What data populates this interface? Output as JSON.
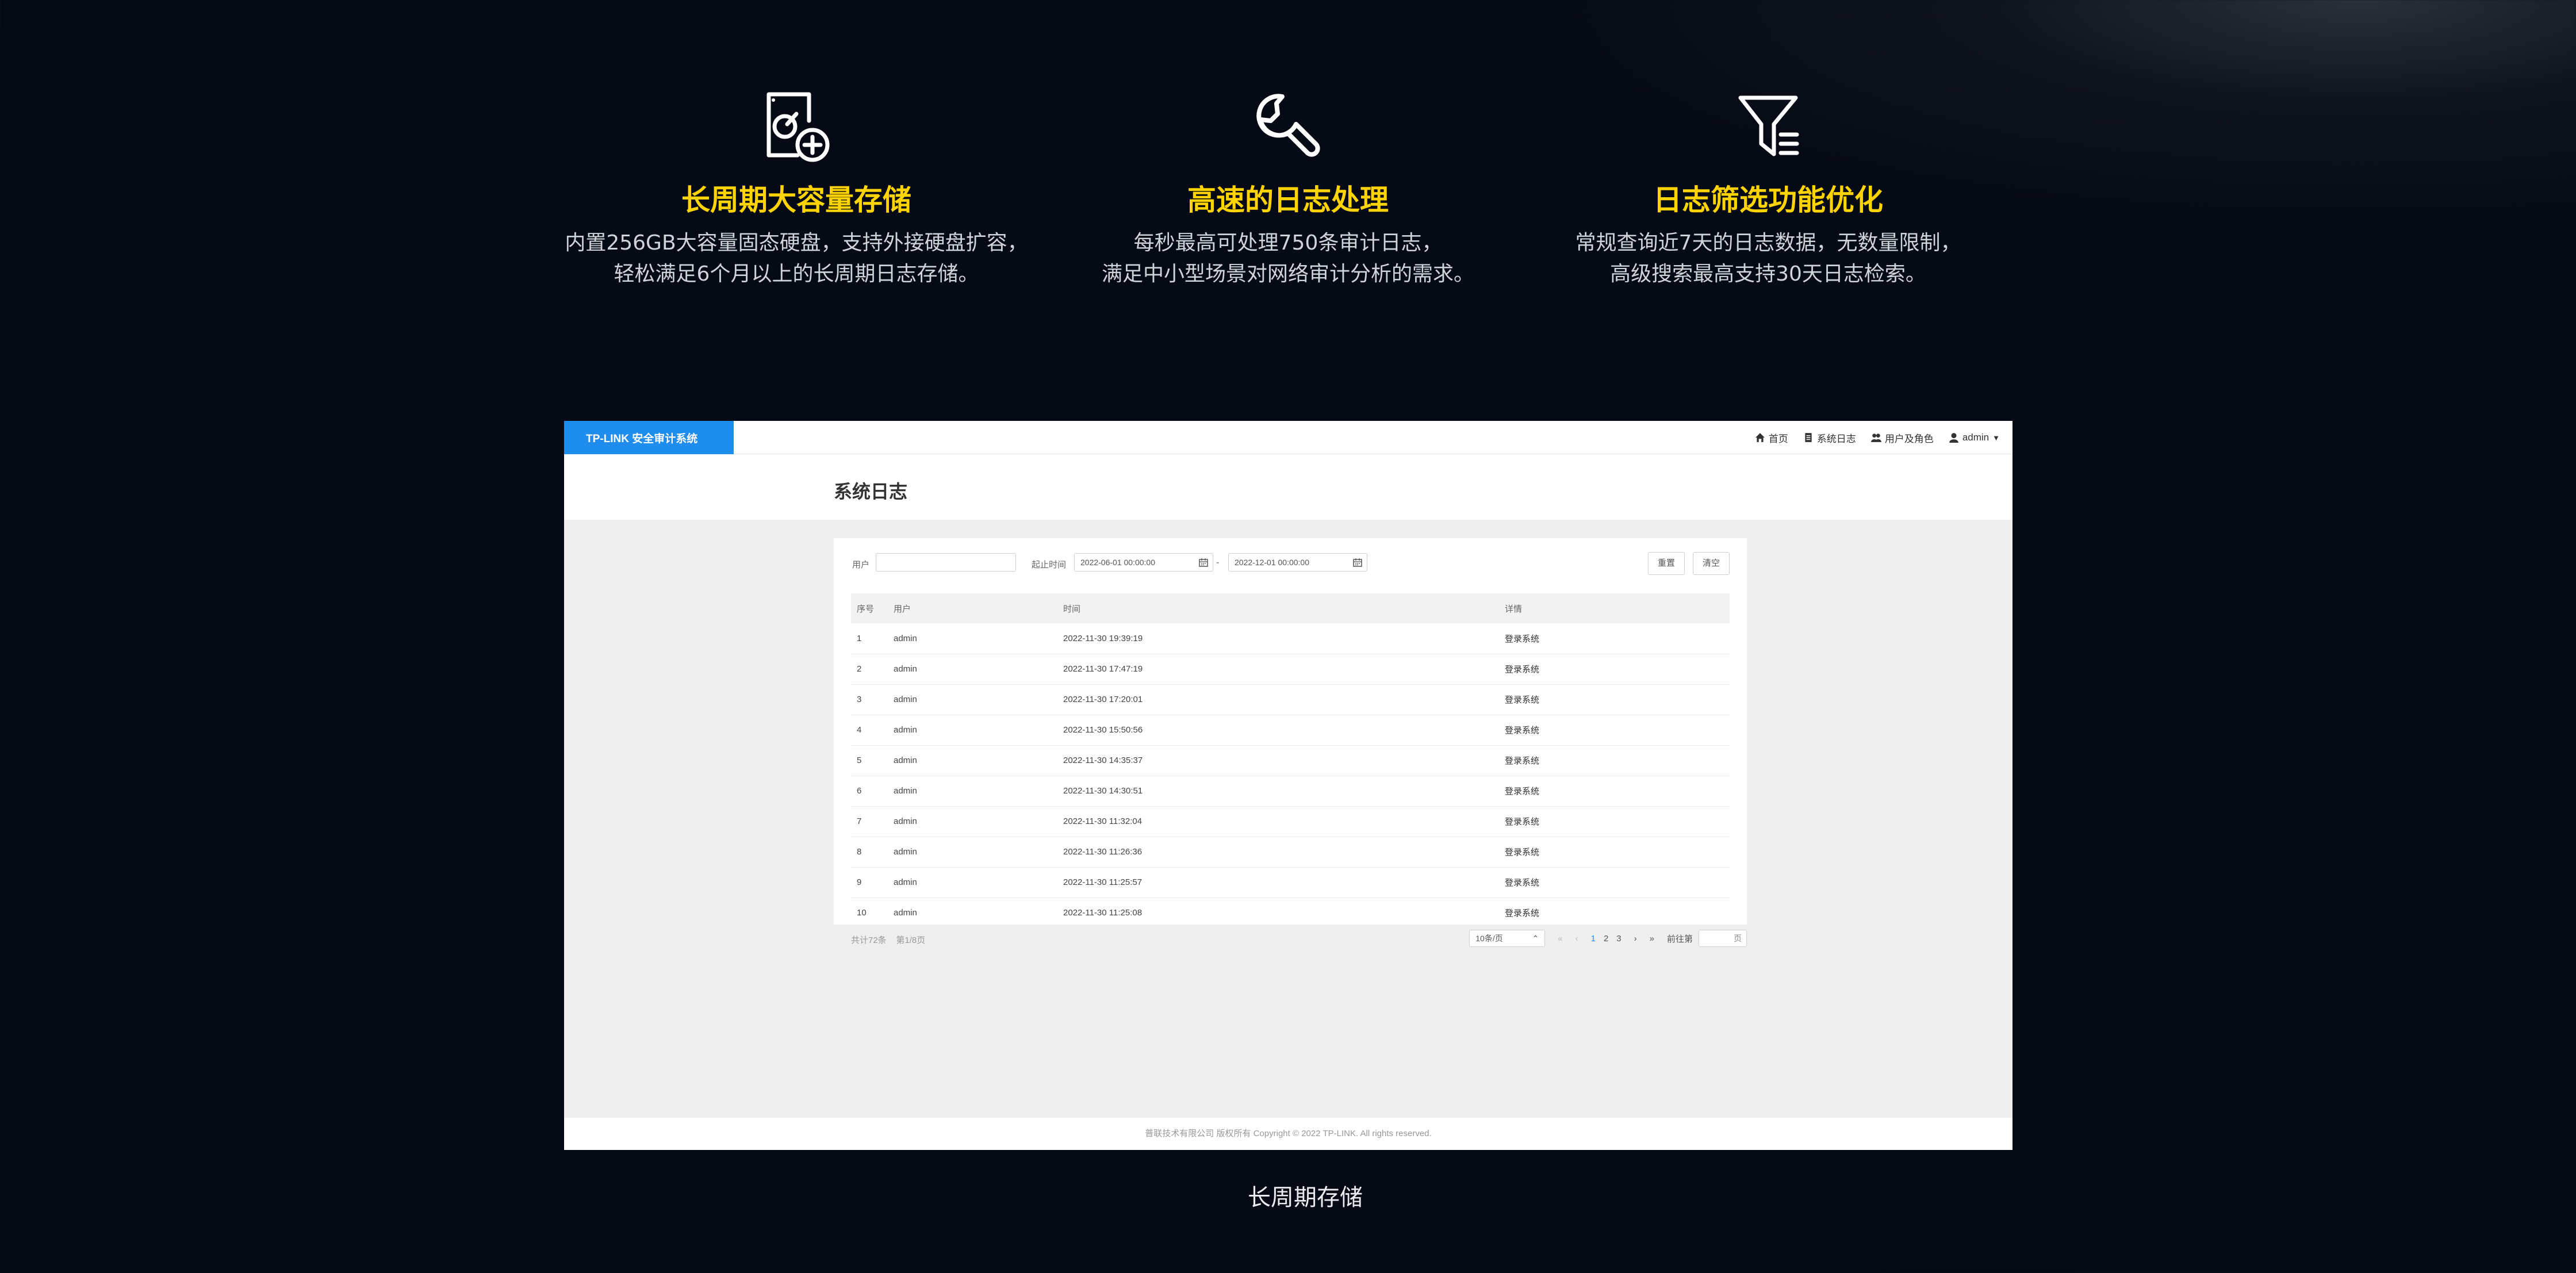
{
  "features": [
    {
      "icon": "disk-plus-icon",
      "title": "长周期大容量存储",
      "desc_line1": "内置256GB大容量固态硬盘，支持外接硬盘扩容，",
      "desc_line2": "轻松满足6个月以上的长周期日志存储。"
    },
    {
      "icon": "wrench-icon",
      "title": "高速的日志处理",
      "desc_line1": "每秒最高可处理750条审计日志，",
      "desc_line2": "满足中小型场景对网络审计分析的需求。"
    },
    {
      "icon": "filter-icon",
      "title": "日志筛选功能优化",
      "desc_line1": "常规查询近7天的日志数据，无数量限制，",
      "desc_line2": "高级搜索最高支持30天日志检索。"
    }
  ],
  "app": {
    "brand": "TP-LINK 安全审计系统",
    "nav": {
      "home": "首页",
      "system_log": "系统日志",
      "users_roles": "用户及角色",
      "account": "admin"
    },
    "page_title": "系统日志",
    "filters": {
      "user_label": "用户",
      "user_value": "",
      "time_label": "起止时间",
      "start": "2022-06-01 00:00:00",
      "separator": "-",
      "end": "2022-12-01 00:00:00",
      "reset": "重置",
      "clear": "清空"
    },
    "table": {
      "headers": [
        "序号",
        "用户",
        "时间",
        "详情"
      ],
      "rows": [
        [
          "1",
          "admin",
          "2022-11-30 19:39:19",
          "登录系统"
        ],
        [
          "2",
          "admin",
          "2022-11-30 17:47:19",
          "登录系统"
        ],
        [
          "3",
          "admin",
          "2022-11-30 17:20:01",
          "登录系统"
        ],
        [
          "4",
          "admin",
          "2022-11-30 15:50:56",
          "登录系统"
        ],
        [
          "5",
          "admin",
          "2022-11-30 14:35:37",
          "登录系统"
        ],
        [
          "6",
          "admin",
          "2022-11-30 14:30:51",
          "登录系统"
        ],
        [
          "7",
          "admin",
          "2022-11-30 11:32:04",
          "登录系统"
        ],
        [
          "8",
          "admin",
          "2022-11-30 11:26:36",
          "登录系统"
        ],
        [
          "9",
          "admin",
          "2022-11-30 11:25:57",
          "登录系统"
        ],
        [
          "10",
          "admin",
          "2022-11-30 11:25:08",
          "登录系统"
        ]
      ]
    },
    "pagination": {
      "total": "共计72条",
      "page_info": "第1/8页",
      "page_size": "10条/页",
      "first": "«",
      "prev": "‹",
      "pages": [
        "1",
        "2",
        "3"
      ],
      "next": "›",
      "last": "»",
      "goto_label": "前往第",
      "goto_unit": "页"
    },
    "copyright": "普联技术有限公司 版权所有 Copyright © 2022 TP-LINK. All rights reserved."
  },
  "caption": "长周期存储",
  "colors": {
    "accent_yellow": "#ffd400",
    "brand_blue": "#1f8ded"
  }
}
